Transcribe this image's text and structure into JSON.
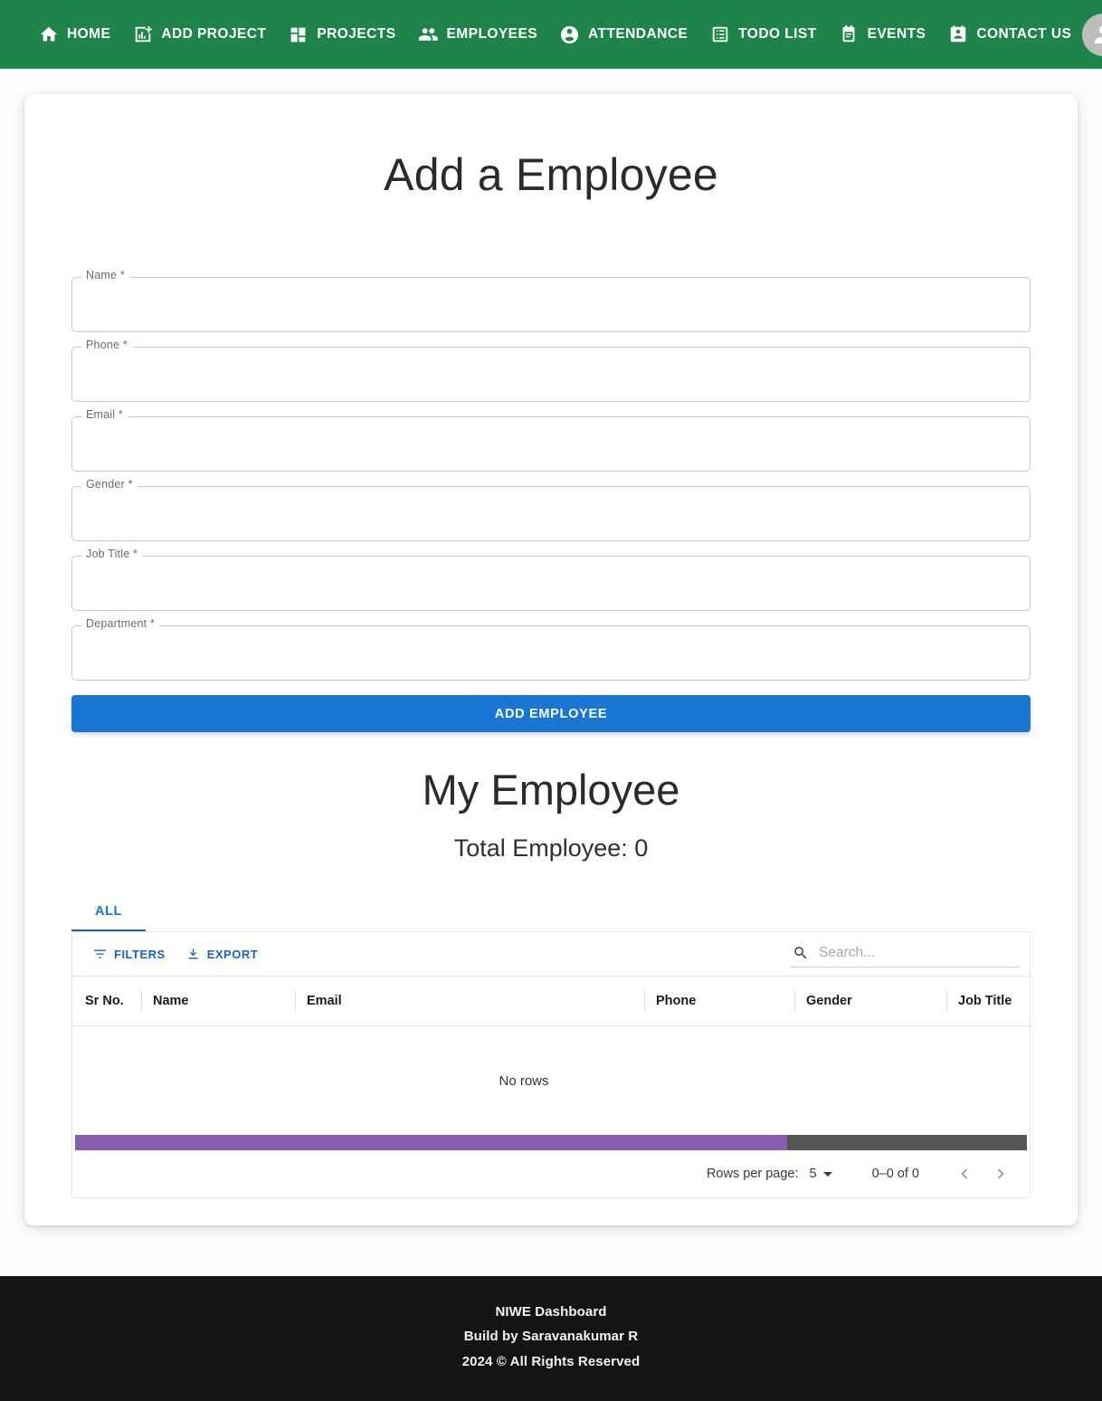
{
  "navbar": {
    "brand_color": "#1e8449",
    "items": [
      {
        "label": "HOME",
        "icon": "home-icon"
      },
      {
        "label": "ADD PROJECT",
        "icon": "add-chart-icon"
      },
      {
        "label": "PROJECTS",
        "icon": "dashboard-icon"
      },
      {
        "label": "EMPLOYEES",
        "icon": "people-icon"
      },
      {
        "label": "ATTENDANCE",
        "icon": "account-circle-icon"
      },
      {
        "label": "TODO LIST",
        "icon": "list-alt-icon"
      },
      {
        "label": "EVENTS",
        "icon": "event-note-icon"
      },
      {
        "label": "CONTACT US",
        "icon": "contact-card-icon"
      }
    ],
    "avatar_icon": "user-avatar-icon"
  },
  "main": {
    "page_title": "Add a Employee",
    "form": {
      "fields": [
        {
          "label": "Name *",
          "value": "",
          "placeholder": ""
        },
        {
          "label": "Phone *",
          "value": "",
          "placeholder": ""
        },
        {
          "label": "Email *",
          "value": "",
          "placeholder": ""
        },
        {
          "label": "Gender *",
          "value": "",
          "placeholder": ""
        },
        {
          "label": "Job Title *",
          "value": "",
          "placeholder": ""
        },
        {
          "label": "Department *",
          "value": "",
          "placeholder": ""
        }
      ],
      "submit_label": "ADD EMPLOYEE",
      "submit_color": "#1976d2"
    },
    "list_section": {
      "title": "My Employee",
      "total_label": "Total Employee: 0",
      "tabs": [
        {
          "label": "ALL",
          "active": true
        }
      ],
      "toolbar": {
        "filters_label": "FILTERS",
        "export_label": "EXPORT",
        "accent_color": "#1565c0"
      },
      "search": {
        "value": "",
        "placeholder": "Search..."
      },
      "columns": [
        "Sr No.",
        "Name",
        "Email",
        "Phone",
        "Gender",
        "Job Title"
      ],
      "rows": [],
      "empty_message": "No rows",
      "scrollbar": {
        "thumb_color": "#8a5cb0",
        "track_color": "#555555"
      },
      "pagination": {
        "rows_per_page_label": "Rows per page:",
        "rows_per_page_value": "5",
        "range_label": "0–0 of 0",
        "prev_icon": "chevron-left-icon",
        "next_icon": "chevron-right-icon"
      }
    }
  },
  "footer": {
    "line1": "NIWE Dashboard",
    "line2": "Build by Saravanakumar R",
    "line3": "2024 © All Rights Reserved"
  }
}
